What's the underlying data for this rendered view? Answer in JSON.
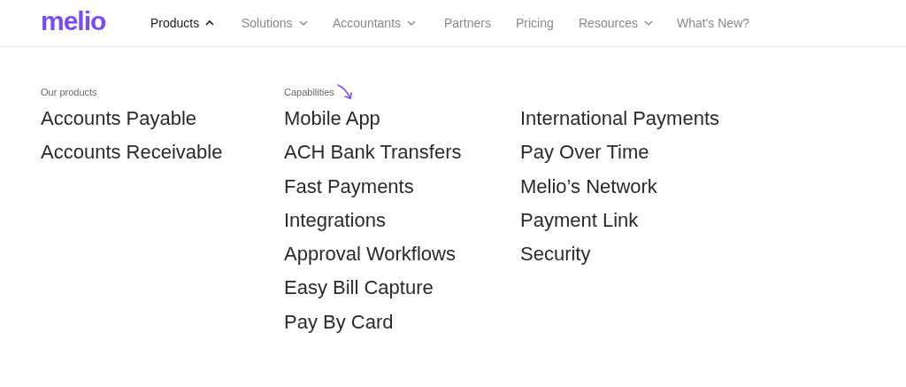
{
  "logo": {
    "text": "melio"
  },
  "nav": [
    {
      "label": "Products",
      "expanded": true,
      "selected": true
    },
    {
      "label": "Solutions",
      "expanded": false,
      "selected": false
    },
    {
      "label": "Accountants",
      "expanded": false,
      "selected": false
    },
    {
      "label": "Partners",
      "selected": false
    },
    {
      "label": "Pricing",
      "selected": false
    },
    {
      "label": "Resources",
      "expanded": false,
      "selected": false
    },
    {
      "label": "What's New?",
      "selected": false
    }
  ],
  "menu": {
    "columns": [
      {
        "heading": "Our products",
        "items": [
          "Accounts Payable",
          "Accounts Receivable"
        ]
      },
      {
        "heading": "Capabilities",
        "pointer_arrow": true,
        "items": [
          "Mobile App",
          "ACH Bank Transfers",
          "Fast Payments",
          "Integrations",
          "Approval Workflows",
          "Easy Bill Capture",
          "Pay By Card"
        ]
      },
      {
        "items": [
          "International Payments",
          "Pay Over Time",
          "Melio’s Network",
          "Payment Link",
          "Security"
        ]
      }
    ]
  }
}
